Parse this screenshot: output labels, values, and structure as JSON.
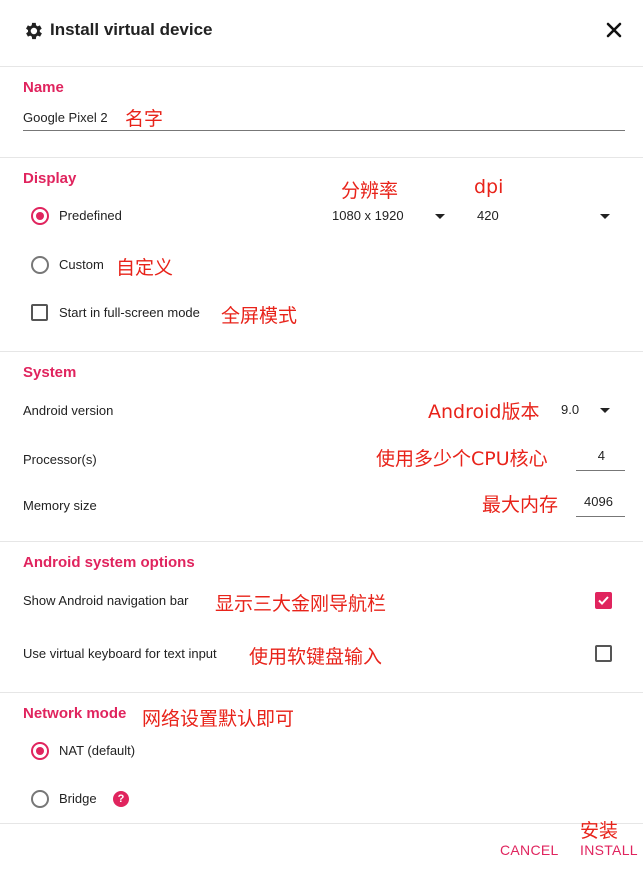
{
  "header": {
    "title": "Install virtual device",
    "settings_icon": "gear-icon",
    "close_icon": "close-icon"
  },
  "name_section": {
    "title": "Name",
    "value": "Google Pixel 2",
    "note": "名字"
  },
  "display": {
    "title": "Display",
    "resolution_note": "分辨率",
    "dpi_note": "dpi",
    "predefined_label": "Predefined",
    "resolution_value": "1080 x 1920",
    "dpi_value": "420",
    "custom_label": "Custom",
    "custom_note": "自定义",
    "fullscreen_label": "Start in full-screen mode",
    "fullscreen_note": "全屏模式"
  },
  "system": {
    "title": "System",
    "android_version_label": "Android version",
    "android_version_note": "Android版本",
    "android_version_value": "9.0",
    "processor_label": "Processor(s)",
    "processor_note": "使用多少个CPU核心",
    "processor_value": "4",
    "memory_label": "Memory size",
    "memory_note": "最大内存",
    "memory_value": "4096"
  },
  "android_options": {
    "title": "Android system options",
    "nav_bar_label": "Show Android navigation bar",
    "nav_bar_note": "显示三大金刚导航栏",
    "nav_bar_checked": true,
    "virtual_keyboard_label": "Use virtual keyboard for text input",
    "virtual_keyboard_note": "使用软键盘输入",
    "virtual_keyboard_checked": false
  },
  "network": {
    "title": "Network mode",
    "note": "网络设置默认即可",
    "nat_label": "NAT (default)",
    "bridge_label": "Bridge",
    "help_glyph": "?"
  },
  "footer": {
    "install_note": "安装",
    "cancel_label": "CANCEL",
    "install_label": "INSTALL"
  },
  "colors": {
    "accent": "#e0245e",
    "annotation": "#e8231a"
  }
}
